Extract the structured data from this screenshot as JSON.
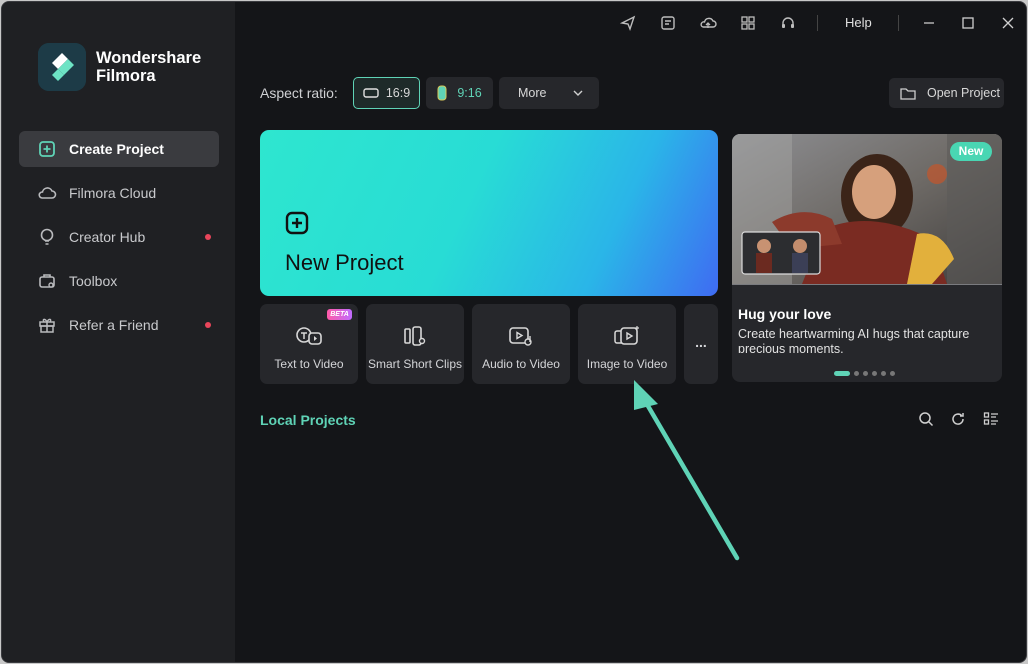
{
  "app": {
    "logo_line1": "Wondershare",
    "logo_line2": "Filmora"
  },
  "sidebar": {
    "items": [
      {
        "label": "Create Project",
        "icon": "plus-square-icon",
        "active": true,
        "dot": false
      },
      {
        "label": "Filmora Cloud",
        "icon": "cloud-icon",
        "active": false,
        "dot": false
      },
      {
        "label": "Creator Hub",
        "icon": "lightbulb-icon",
        "active": false,
        "dot": true
      },
      {
        "label": "Toolbox",
        "icon": "toolbox-icon",
        "active": false,
        "dot": false
      },
      {
        "label": "Refer a Friend",
        "icon": "gift-icon",
        "active": false,
        "dot": true
      }
    ]
  },
  "titlebar": {
    "help_label": "Help",
    "icons": [
      "send-icon",
      "clipboard-icon",
      "cloud-upload-icon",
      "grid-icon",
      "headset-icon",
      "minimize-icon",
      "maximize-icon",
      "close-icon"
    ]
  },
  "toolbar": {
    "aspect_label": "Aspect ratio:",
    "ratio_16_9": "16:9",
    "ratio_9_16": "9:16",
    "more_label": "More",
    "open_project_label": "Open Project"
  },
  "new_project": {
    "label": "New Project"
  },
  "tools": [
    {
      "label": "Text to Video",
      "badge": "BETA",
      "icon": "text-to-video-icon"
    },
    {
      "label": "Smart Short Clips",
      "icon": "smart-clips-icon"
    },
    {
      "label": "Audio to Video",
      "icon": "audio-to-video-icon"
    },
    {
      "label": "Image to Video",
      "icon": "image-to-video-icon"
    },
    {
      "label": "...",
      "icon": "more-dots-icon"
    }
  ],
  "promo": {
    "badge": "New",
    "title": "Hug your love",
    "description": "Create heartwarming AI hugs that capture precious moments.",
    "slides": 6,
    "active_slide": 1
  },
  "local_projects": {
    "title": "Local Projects"
  },
  "colors": {
    "accent": "#5fd3b6",
    "dot_red": "#e8455a",
    "bg": "#141518",
    "sidebar": "#1f2023"
  }
}
